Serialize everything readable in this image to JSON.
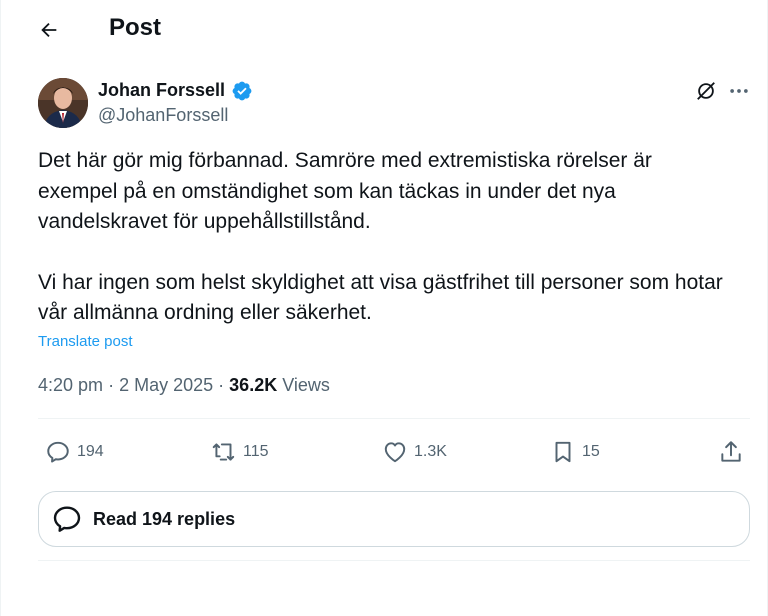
{
  "header": {
    "title": "Post",
    "back_icon": "arrow-left-icon"
  },
  "author": {
    "name": "Johan Forssell",
    "handle": "@JohanForssell",
    "verified": true,
    "verified_color": "#1d9bf0"
  },
  "post": {
    "paragraphs": [
      "Det här gör mig förbannad. Samröre med extremistiska rörelser är exempel på en omständighet som kan täckas in under det nya vandelskravet för uppehållstillstånd.",
      "Vi har ingen som helst skyldighet att visa gästfrihet till personer som hotar vår allmänna ordning eller säkerhet."
    ],
    "translate_label": "Translate post"
  },
  "meta": {
    "time": "4:20 pm",
    "sep1": "·",
    "date": "2 May 2025",
    "sep2": "·",
    "views_count": "36.2K",
    "views_label": "Views"
  },
  "actions": {
    "replies": {
      "icon": "reply-icon",
      "count": "194"
    },
    "reposts": {
      "icon": "repost-icon",
      "count": "115"
    },
    "likes": {
      "icon": "heart-icon",
      "count": "1.3K"
    },
    "bookmarks": {
      "icon": "bookmark-icon",
      "count": "15"
    },
    "share": {
      "icon": "share-icon"
    }
  },
  "read_replies": {
    "label": "Read 194 replies",
    "icon": "reply-icon"
  },
  "colors": {
    "text": "#0f1419",
    "secondary": "#536471",
    "accent": "#1d9bf0",
    "border": "#cfd9de"
  }
}
